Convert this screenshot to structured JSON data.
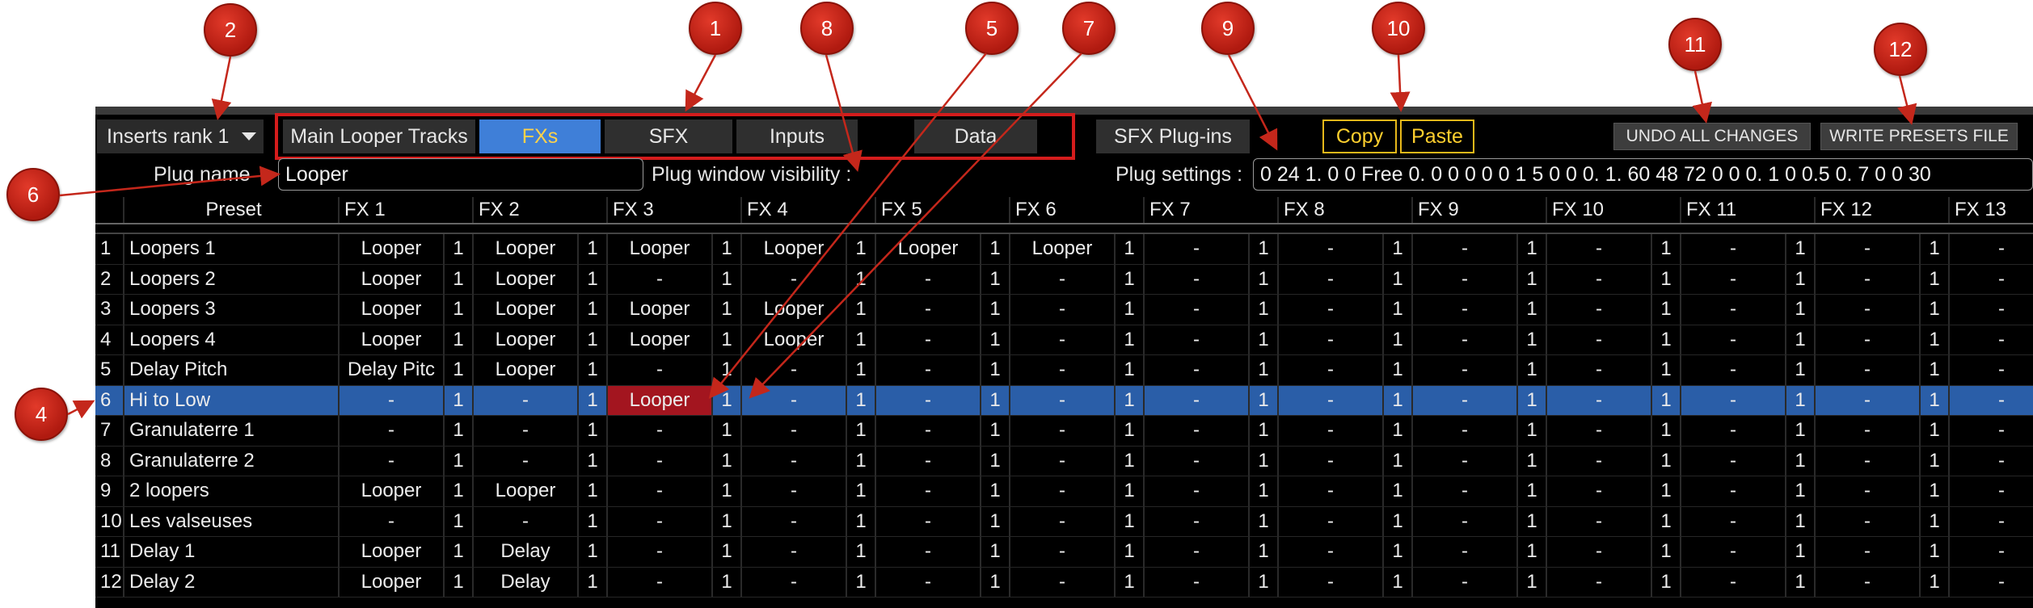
{
  "toolbar": {
    "rank_label": "Inserts rank 1",
    "tabs": [
      "Main Looper Tracks",
      "FXs",
      "SFX",
      "Inputs",
      "Data"
    ],
    "active_tab": "FXs",
    "sfx_plugins": "SFX Plug-ins",
    "copy": "Copy",
    "paste": "Paste",
    "undo": "UNDO ALL CHANGES",
    "write": "WRITE PRESETS FILE"
  },
  "plug": {
    "name_label": "Plug name",
    "name_value": "Looper",
    "visibility_label": "Plug window visibility :",
    "settings_label": "Plug settings :",
    "settings_value": "0 24 1. 0 0 Free 0. 0 0 0 0 0 1 5 0 0 0. 1. 60 48 72 0 0 0. 1 0 0.5 0. 7 0 0 30"
  },
  "table": {
    "headers": [
      "Preset",
      "FX 1",
      "FX 2",
      "FX 3",
      "FX 4",
      "FX 5",
      "FX 6",
      "FX 7",
      "FX 8",
      "FX 9",
      "FX 10",
      "FX 11",
      "FX 12",
      "FX 13"
    ],
    "rows": [
      {
        "num": "1",
        "name": "Loopers 1",
        "fx": [
          "Looper",
          "Looper",
          "Looper",
          "Looper",
          "Looper",
          "Looper",
          "-",
          "-",
          "-",
          "-",
          "-",
          "-"
        ]
      },
      {
        "num": "2",
        "name": "Loopers 2",
        "fx": [
          "Looper",
          "Looper",
          "-",
          "-",
          "-",
          "-",
          "-",
          "-",
          "-",
          "-",
          "-",
          "-"
        ]
      },
      {
        "num": "3",
        "name": "Loopers 3",
        "fx": [
          "Looper",
          "Looper",
          "Looper",
          "Looper",
          "-",
          "-",
          "-",
          "-",
          "-",
          "-",
          "-",
          "-"
        ]
      },
      {
        "num": "4",
        "name": "Loopers 4",
        "fx": [
          "Looper",
          "Looper",
          "Looper",
          "Looper",
          "-",
          "-",
          "-",
          "-",
          "-",
          "-",
          "-",
          "-"
        ]
      },
      {
        "num": "5",
        "name": "Delay Pitch",
        "fx": [
          "Delay Pitc",
          "Looper",
          "-",
          "-",
          "-",
          "-",
          "-",
          "-",
          "-",
          "-",
          "-",
          "-"
        ]
      },
      {
        "num": "6",
        "name": "Hi to Low",
        "fx": [
          "-",
          "-",
          "Looper",
          "-",
          "-",
          "-",
          "-",
          "-",
          "-",
          "-",
          "-",
          "-"
        ]
      },
      {
        "num": "7",
        "name": "Granulaterre 1",
        "fx": [
          "-",
          "-",
          "-",
          "-",
          "-",
          "-",
          "-",
          "-",
          "-",
          "-",
          "-",
          "-"
        ]
      },
      {
        "num": "8",
        "name": "Granulaterre 2",
        "fx": [
          "-",
          "-",
          "-",
          "-",
          "-",
          "-",
          "-",
          "-",
          "-",
          "-",
          "-",
          "-"
        ]
      },
      {
        "num": "9",
        "name": "2 loopers",
        "fx": [
          "Looper",
          "Looper",
          "-",
          "-",
          "-",
          "-",
          "-",
          "-",
          "-",
          "-",
          "-",
          "-"
        ]
      },
      {
        "num": "10",
        "name": "Les valseuses",
        "fx": [
          "-",
          "-",
          "-",
          "-",
          "-",
          "-",
          "-",
          "-",
          "-",
          "-",
          "-",
          "-"
        ]
      },
      {
        "num": "11",
        "name": "Delay 1",
        "fx": [
          "Looper",
          "Delay",
          "-",
          "-",
          "-",
          "-",
          "-",
          "-",
          "-",
          "-",
          "-",
          "-"
        ]
      },
      {
        "num": "12",
        "name": "Delay 2",
        "fx": [
          "Looper",
          "Delay",
          "-",
          "-",
          "-",
          "-",
          "-",
          "-",
          "-",
          "-",
          "-",
          "-"
        ]
      }
    ],
    "channel_value": "1",
    "selected_row": 5,
    "highlight_fx": 2,
    "trailing_value": "-"
  },
  "callouts": [
    "1",
    "2",
    "4",
    "5",
    "6",
    "7",
    "8",
    "9",
    "10",
    "11",
    "12"
  ],
  "colors": {
    "accent": "#3f7fd8",
    "selected_row": "#2a5ea8",
    "highlight": "#a3151f",
    "callout": "#c4271b",
    "frame": "#d41c1c",
    "copy_paste": "#ffcf2e"
  }
}
